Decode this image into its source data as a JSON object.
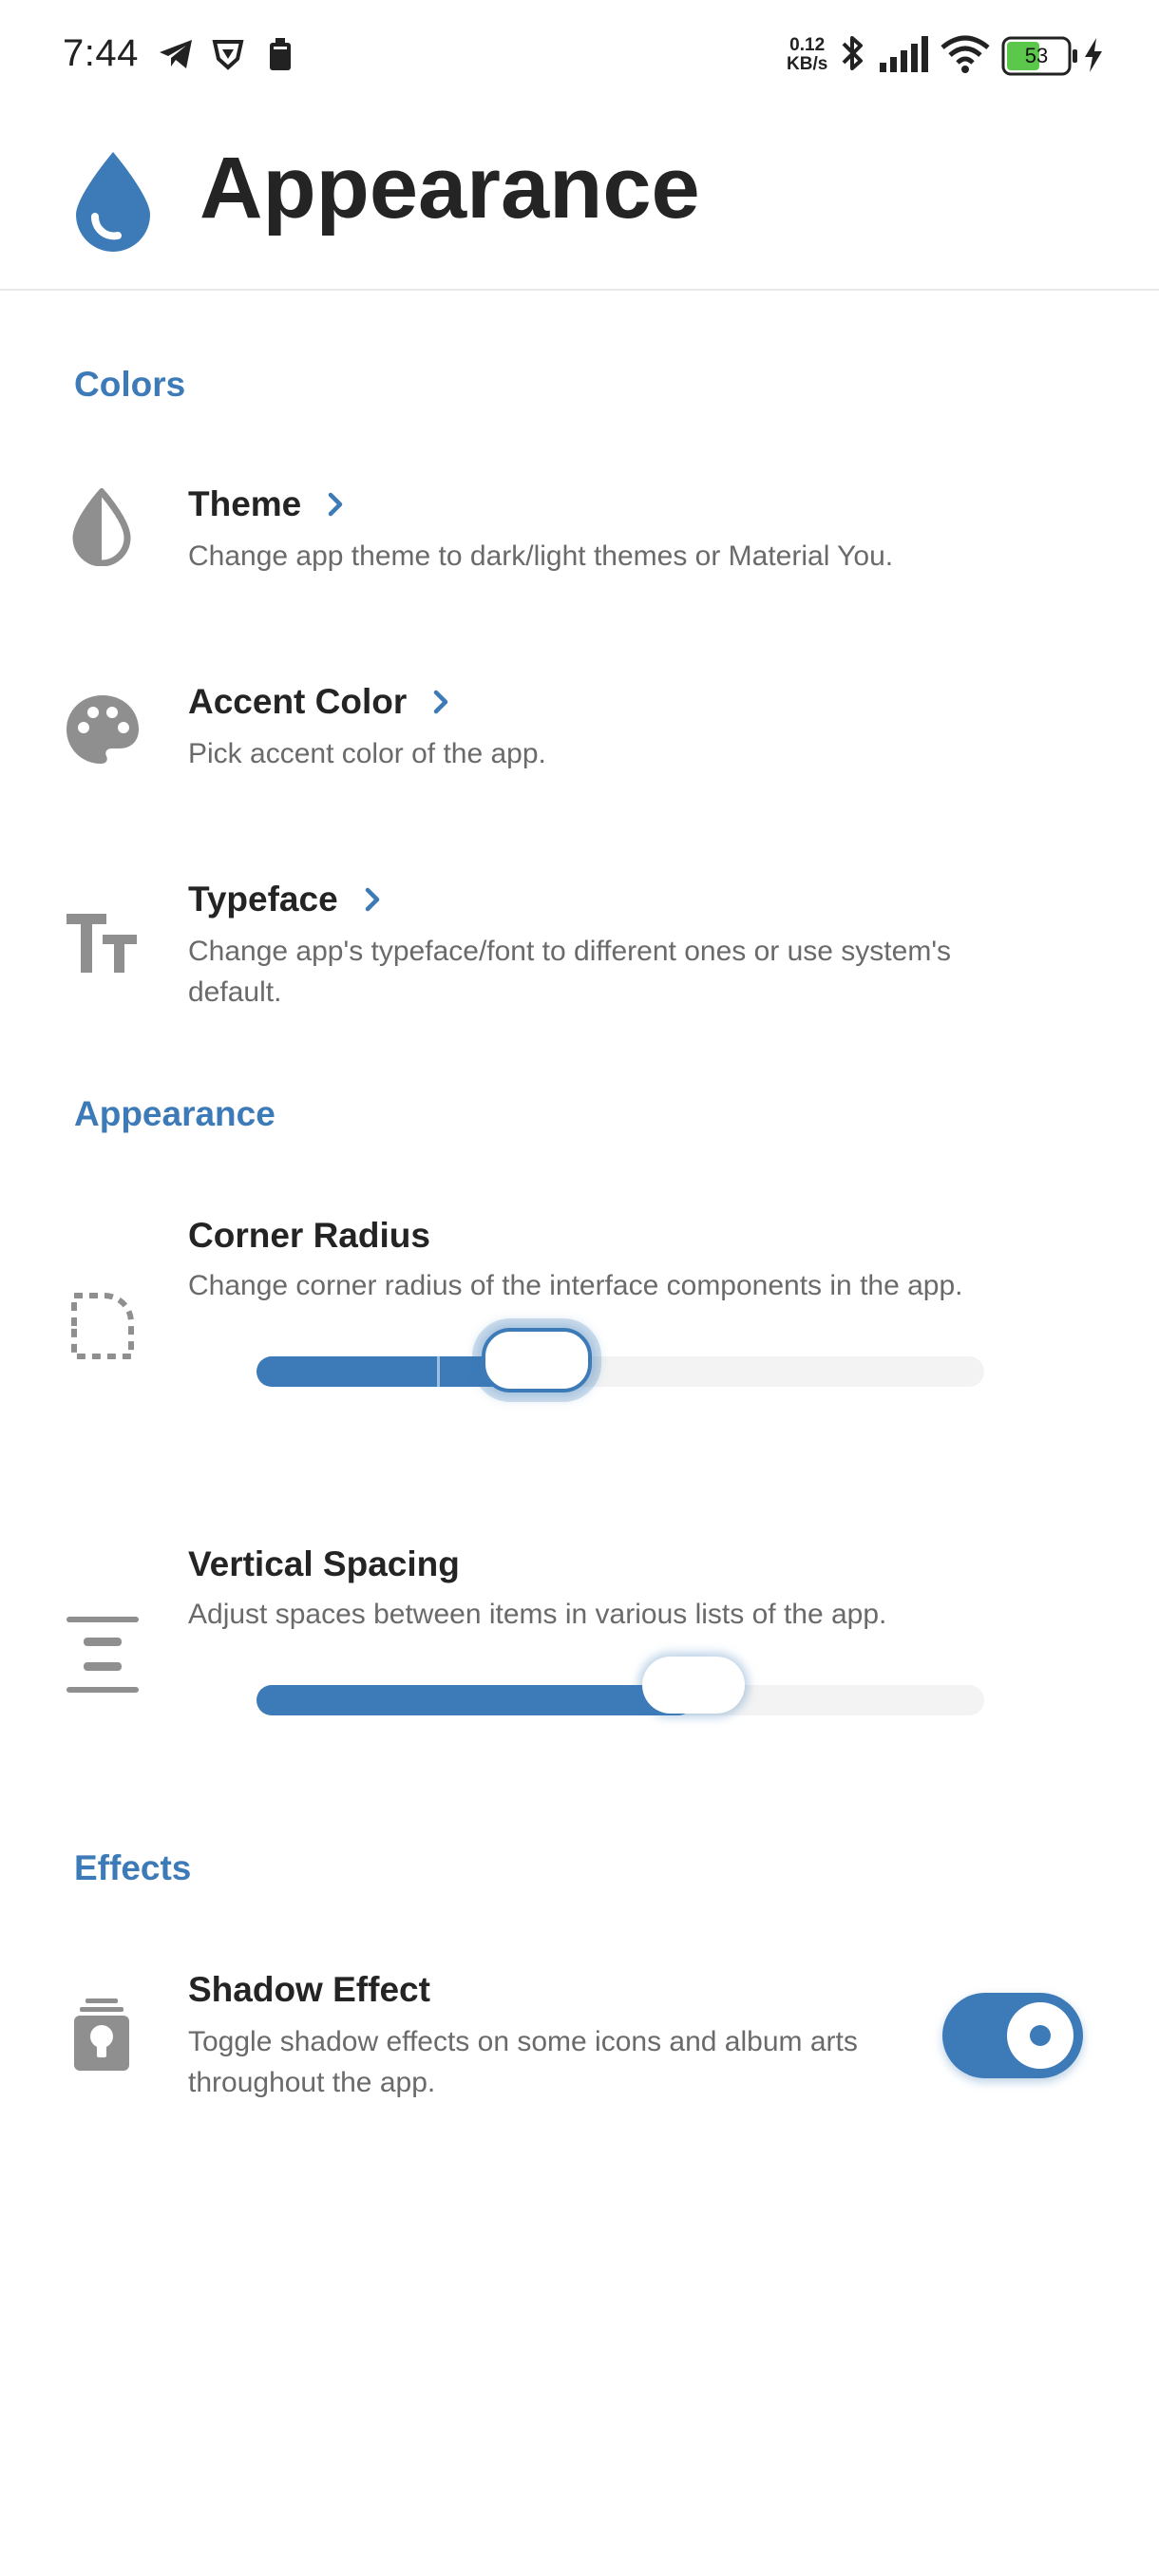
{
  "status_bar": {
    "time": "7:44",
    "net_speed_value": "0.12",
    "net_speed_unit": "KB/s",
    "battery": "53",
    "icons": [
      "telegram-icon",
      "brave-icon",
      "battery-saver-icon",
      "bluetooth-icon",
      "signal-icon",
      "wifi-icon",
      "battery-icon",
      "charging-icon"
    ]
  },
  "header": {
    "title": "Appearance",
    "icon": "water-drop-icon"
  },
  "accent_color": "#3d7ab8",
  "sections": {
    "colors": "Colors",
    "appearance": "Appearance",
    "effects": "Effects"
  },
  "rows": {
    "theme": {
      "title": "Theme",
      "subtitle": "Change app theme to dark/light themes or Material You.",
      "icon": "contrast-drop-icon"
    },
    "accent": {
      "title": "Accent Color",
      "subtitle": "Pick accent color of the app.",
      "icon": "palette-icon"
    },
    "typeface": {
      "title": "Typeface",
      "subtitle": "Change app's typeface/font to different ones or use system's default.",
      "icon": "text-size-icon"
    },
    "corner_radius": {
      "title": "Corner Radius",
      "subtitle": "Change corner radius of the interface components in the app.",
      "icon": "rounded-corner-icon",
      "value_fraction": 0.38
    },
    "vertical_spacing": {
      "title": "Vertical Spacing",
      "subtitle": "Adjust spaces between items in various lists of the app.",
      "icon": "vertical-spacing-icon",
      "value_fraction": 0.6
    },
    "shadow": {
      "title": "Shadow Effect",
      "subtitle": "Toggle shadow effects on some icons and album arts throughout the app.",
      "icon": "shadow-lamp-icon",
      "enabled": true
    }
  }
}
